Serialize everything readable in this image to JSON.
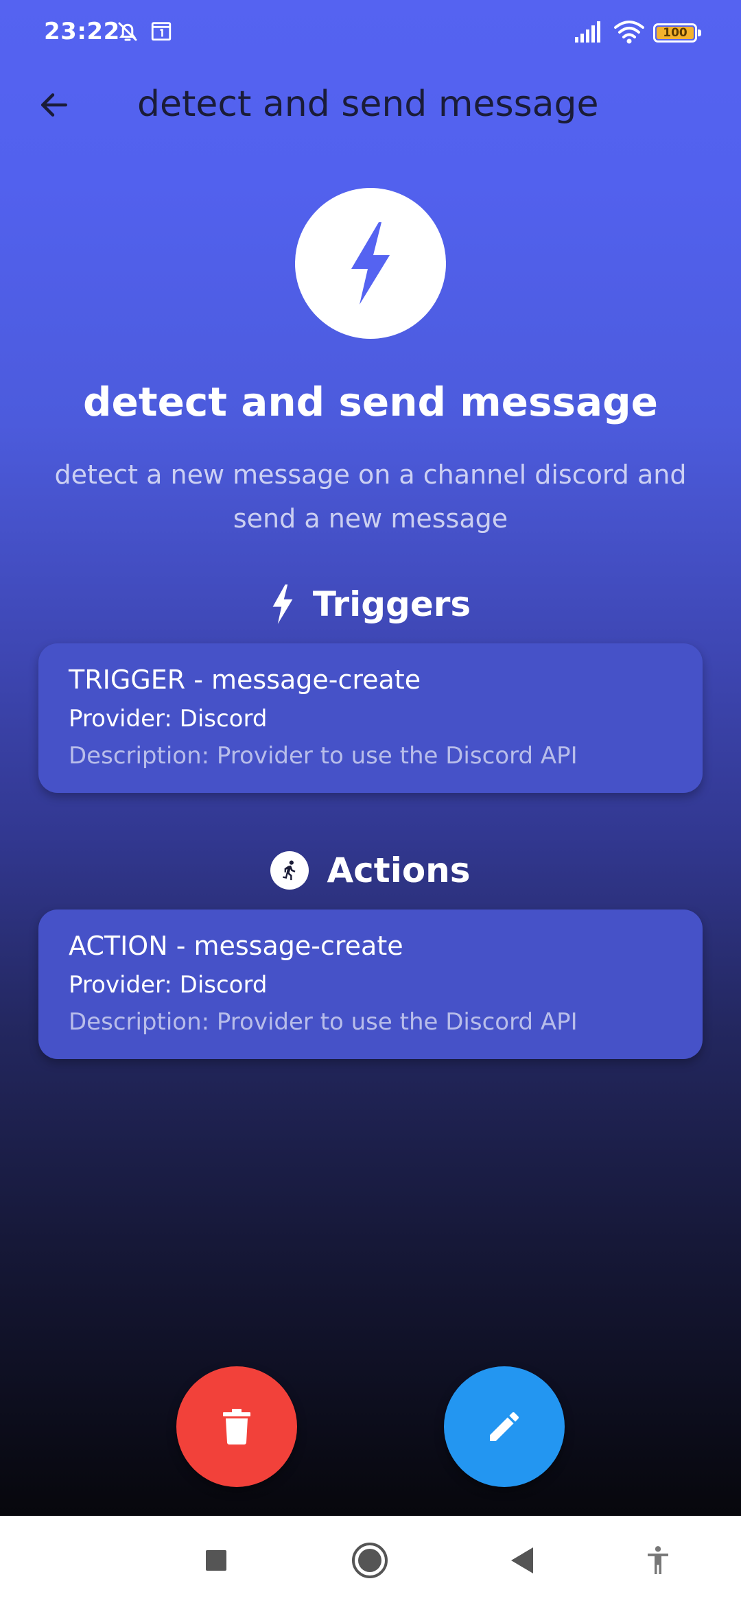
{
  "status_bar": {
    "time": "23:22",
    "icons": [
      "bell-off-icon",
      "calendar-icon",
      "signal-icon",
      "wifi-icon",
      "battery-icon"
    ],
    "battery_level": "100"
  },
  "header": {
    "title": "detect and send message",
    "back_icon": "arrow-left-icon",
    "title_color": "#1a1c38"
  },
  "hero": {
    "icon": "lightning-bolt-icon",
    "title": "detect and send message",
    "description": "detect a new message on a channel discord and send a new message"
  },
  "triggers": {
    "heading": "Triggers",
    "icon": "lightning-bolt-icon",
    "items": [
      {
        "title": "TRIGGER - message-create",
        "provider": "Provider: Discord",
        "description": "Description: Provider to use the Discord API"
      }
    ]
  },
  "actions": {
    "heading": "Actions",
    "icon": "running-person-icon",
    "items": [
      {
        "title": "ACTION - message-create",
        "provider": "Provider: Discord",
        "description": "Description: Provider to use the Discord API"
      }
    ]
  },
  "fabs": {
    "delete_icon": "trash-icon",
    "edit_icon": "pencil-icon",
    "delete_color": "#f2413a",
    "edit_color": "#2396f1"
  },
  "nav_bar": {
    "icons": [
      "recents-square-icon",
      "home-circle-icon",
      "back-triangle-icon",
      "accessibility-icon"
    ]
  },
  "colors": {
    "gradient_top": "#5563f1",
    "gradient_bottom": "#07070c",
    "card_background": "#4652c8"
  }
}
